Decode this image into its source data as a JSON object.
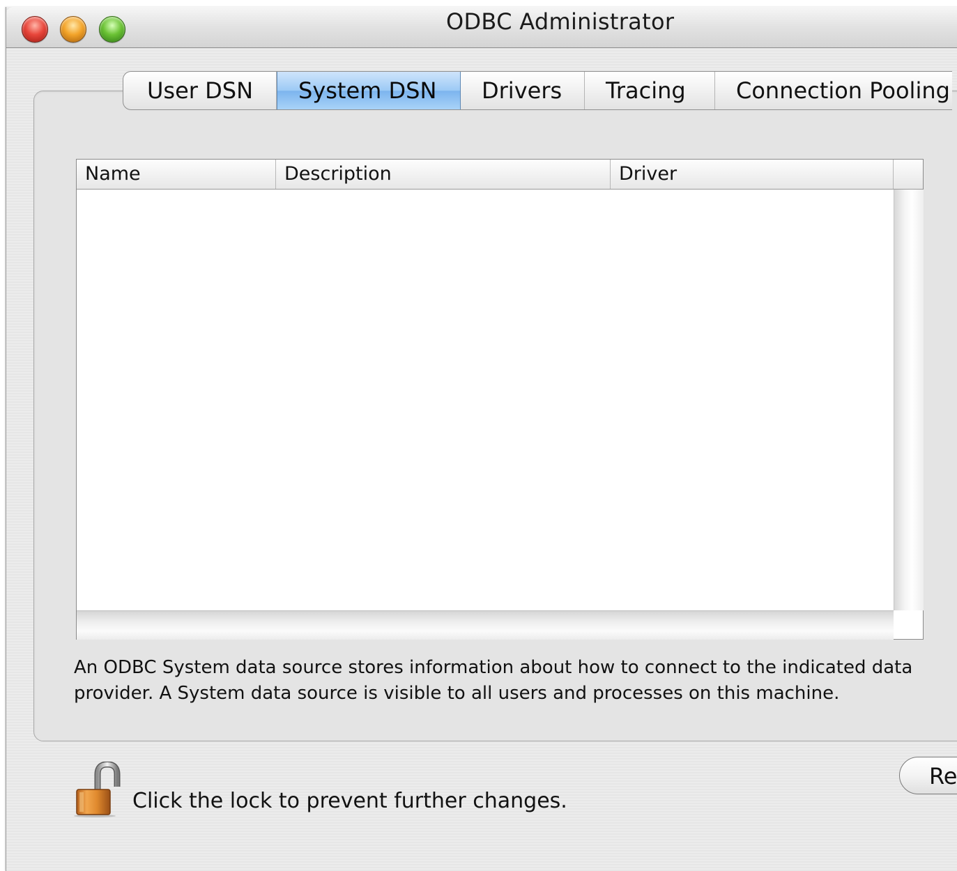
{
  "window": {
    "title": "ODBC Administrator"
  },
  "tabs": [
    {
      "label": "User DSN",
      "selected": false
    },
    {
      "label": "System DSN",
      "selected": true
    },
    {
      "label": "Drivers",
      "selected": false
    },
    {
      "label": "Tracing",
      "selected": false
    },
    {
      "label": "Connection Pooling",
      "selected": false
    }
  ],
  "table": {
    "columns": [
      "Name",
      "Description",
      "Driver"
    ],
    "rows": []
  },
  "description": {
    "line1": "An ODBC System data source stores information about how to connect to the indicated data",
    "line2": "provider. A System data source is visible to all users and processes on this machine."
  },
  "footer": {
    "lock_text": "Click the lock to prevent further changes.",
    "button_label": "Revert"
  },
  "icons": {
    "lock": "lock-open-icon"
  },
  "colors": {
    "selected_tab": "#9ccaf5",
    "close_button": "#e8463b",
    "minimize_button": "#f3a42a",
    "zoom_button": "#6bc234"
  }
}
